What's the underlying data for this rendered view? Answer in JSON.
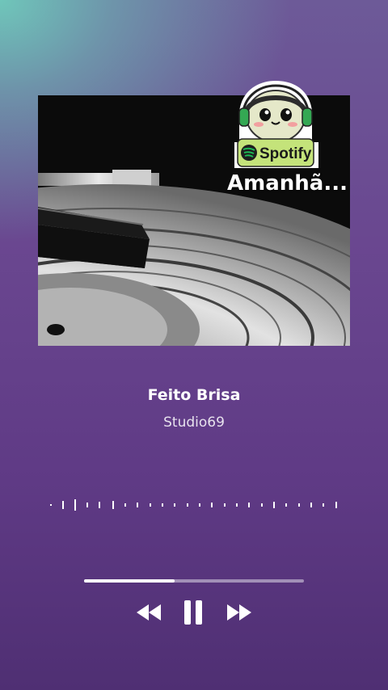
{
  "artwork": {
    "badge_brand": "Spotify",
    "overlay_text": "Amanhã...",
    "brand_color": "#1db954"
  },
  "track": {
    "title": "Feito Brisa",
    "artist": "Studio69"
  },
  "playback": {
    "progress": 0.41,
    "state": "playing"
  },
  "icons": {
    "prev": "rewind-icon",
    "pause": "pause-icon",
    "next": "fast-forward-icon"
  },
  "colors": {
    "background_top": "#6fc6ba",
    "background_main": "#6a4790",
    "text": "#ffffff"
  }
}
